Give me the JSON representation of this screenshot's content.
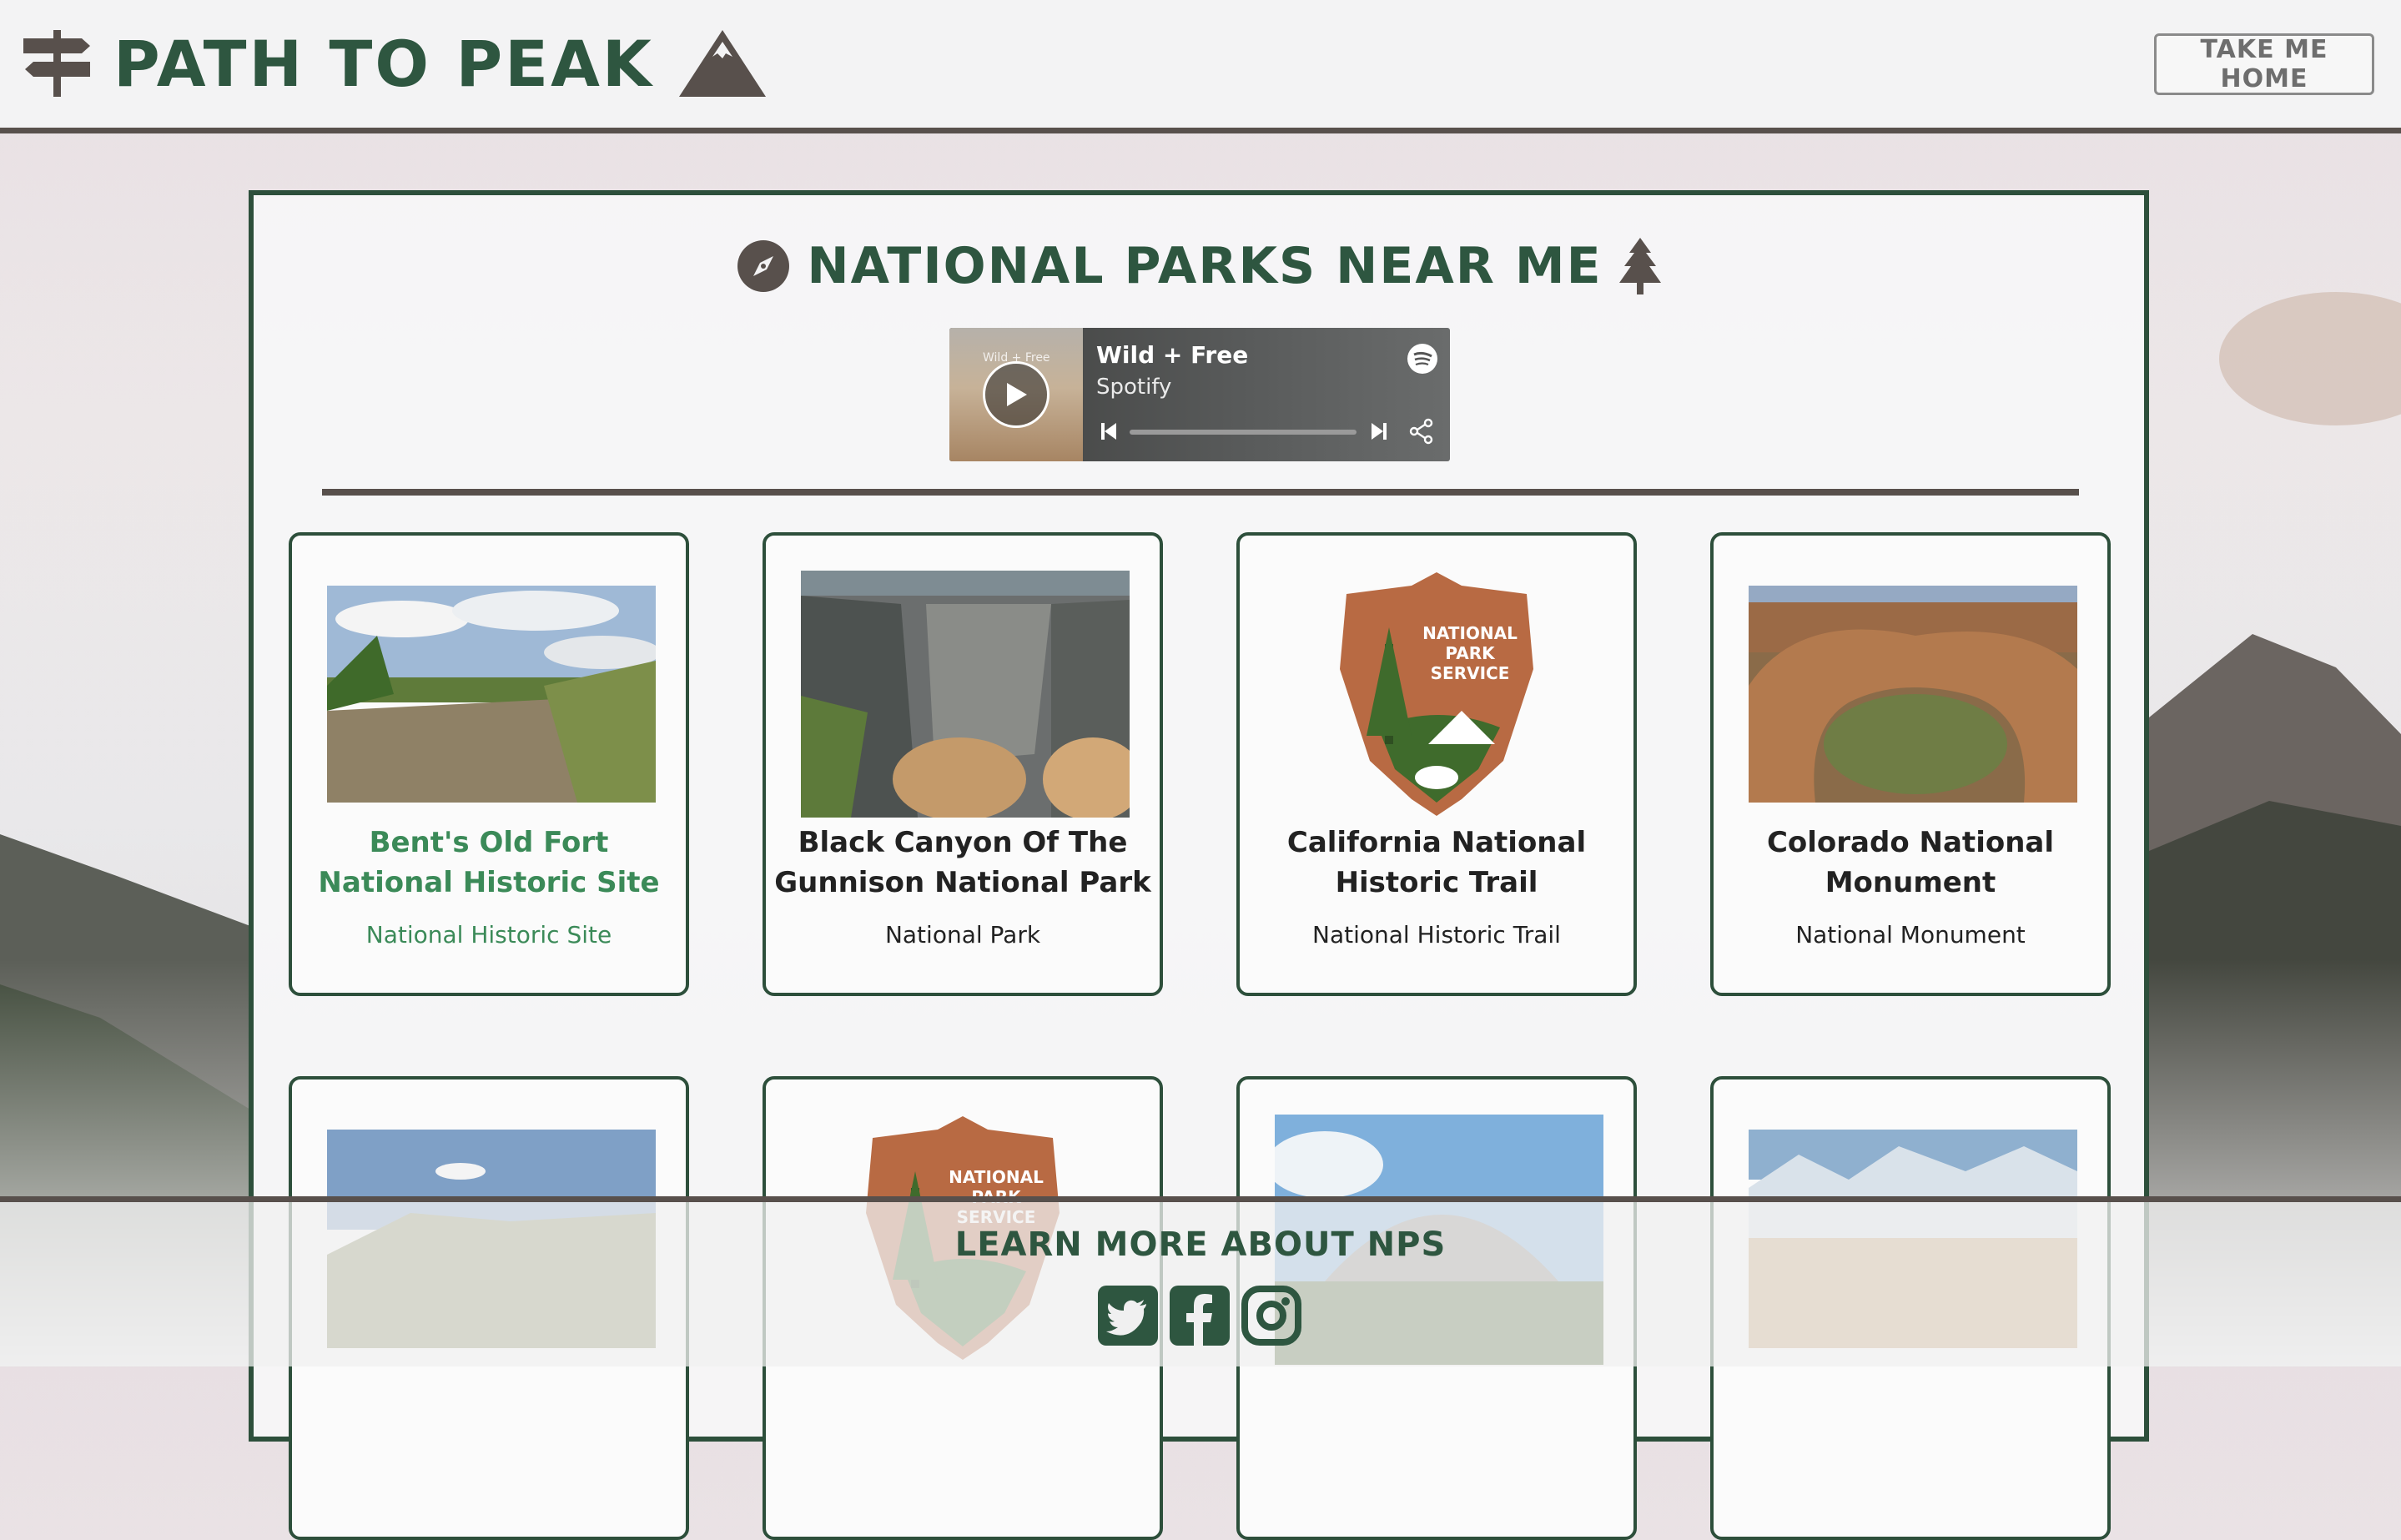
{
  "header": {
    "brand": "PATH TO PEAK",
    "home_button": "TAKE ME HOME"
  },
  "panel": {
    "title": "NATIONAL PARKS NEAR ME"
  },
  "player": {
    "title": "Wild + Free",
    "artist": "Spotify",
    "art_text": "Wild + Free"
  },
  "parks": [
    {
      "name": "Bent's Old Fort National Historic Site",
      "type": "National Historic Site"
    },
    {
      "name": "Black Canyon Of The Gunnison National Park",
      "type": "National Park"
    },
    {
      "name": "California National Historic Trail",
      "type": "National Historic Trail"
    },
    {
      "name": "Colorado National Monument",
      "type": "National Monument"
    }
  ],
  "nps_badge_text": "NATIONAL PARK SERVICE",
  "footer": {
    "title": "LEARN MORE ABOUT NPS"
  },
  "colors": {
    "brand_green": "#2e5640",
    "active_green": "#3b8a58",
    "brown": "#58504c",
    "nps_brown": "#b86a43"
  },
  "icons": [
    "signpost-icon",
    "mountain-icon",
    "compass-icon",
    "pine-tree-icon",
    "play-icon",
    "spotify-icon",
    "skip-back-icon",
    "skip-forward-icon",
    "share-icon",
    "twitter-icon",
    "facebook-icon",
    "instagram-icon"
  ]
}
